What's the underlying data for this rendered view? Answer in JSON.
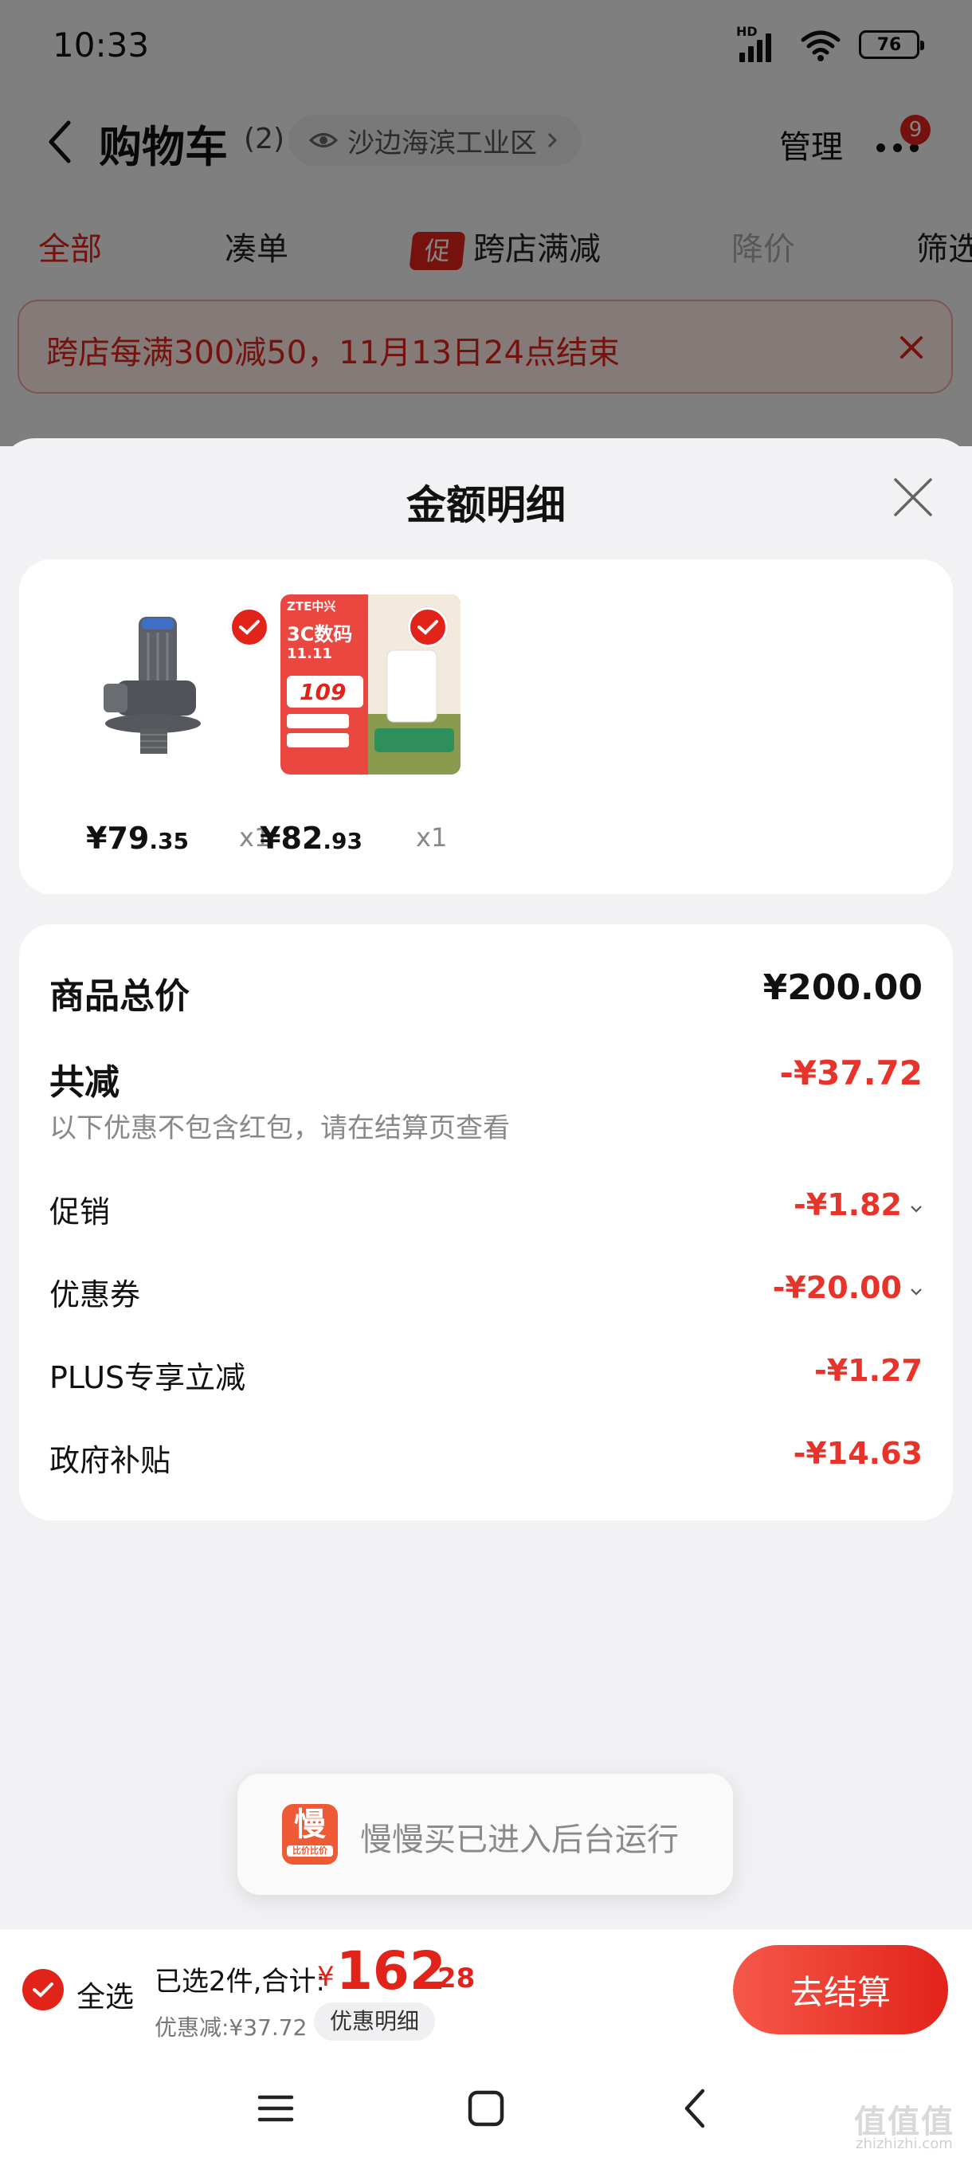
{
  "status_bar": {
    "time": "10:33",
    "network_badge": "HD",
    "battery": "76"
  },
  "header": {
    "title": "购物车",
    "count": "(2)",
    "location": "沙边海滨工业区",
    "manage_label": "管理",
    "notification_count": "9"
  },
  "filter_tabs": {
    "all": "全部",
    "bundle": "凑单",
    "promo_chip": "促",
    "cross_store": "跨店满减",
    "price_drop": "降价",
    "filter": "筛选"
  },
  "promo_banner": {
    "text": "跨店每满300减50，11月13日24点结束"
  },
  "sheet": {
    "title": "金额明细",
    "items": [
      {
        "price_int": "¥79",
        "price_dec": ".35",
        "qty": "x1",
        "image": "angle-valve-product"
      },
      {
        "price_int": "¥82",
        "price_dec": ".93",
        "qty": "x1",
        "image": "zte-router-product",
        "img_brand": "ZTE中兴",
        "img_headline": "3C数码",
        "img_date": "11.11",
        "img_price": "109"
      }
    ],
    "subtotal": {
      "label": "商品总价",
      "value": "¥200.00"
    },
    "discount": {
      "label": "共减",
      "value": "-¥37.72",
      "note": "以下优惠不包含红包，请在结算页查看"
    },
    "lines": [
      {
        "label": "促销",
        "value": "-¥1.82",
        "expandable": true
      },
      {
        "label": "优惠券",
        "value": "-¥20.00",
        "expandable": true
      },
      {
        "label": "PLUS专享立减",
        "value": "-¥1.27",
        "expandable": false
      },
      {
        "label": "政府补贴",
        "value": "-¥14.63",
        "expandable": false
      }
    ]
  },
  "toast": {
    "app_glyph": "慢",
    "app_sub": "比价比价",
    "text": "慢慢买已进入后台运行"
  },
  "checkout": {
    "select_all": "全选",
    "selected_info": "已选2件,合计:",
    "total_yen": "¥",
    "total_int": "162",
    "total_dec": ".28",
    "saved": "优惠减:¥37.72",
    "detail_pill": "优惠明细",
    "button": "去结算"
  },
  "watermark": {
    "text": "值值值",
    "sub": "zhizhizhi.com"
  },
  "colors": {
    "accent": "#e2231a",
    "discount_red": "#e8332a",
    "checkout_gradient_start": "#f5584a"
  }
}
